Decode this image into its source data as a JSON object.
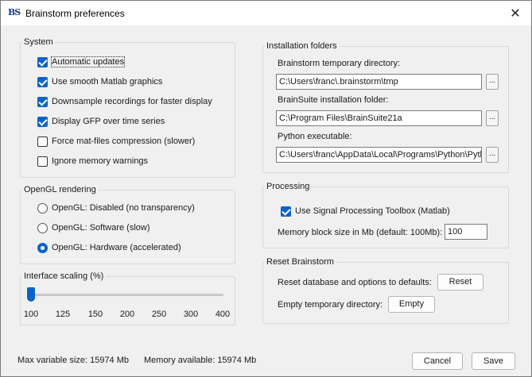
{
  "window": {
    "title": "Brainstorm preferences",
    "logo": "BS"
  },
  "system": {
    "legend": "System",
    "options": [
      {
        "label": "Automatic updates",
        "checked": true
      },
      {
        "label": "Use smooth Matlab graphics",
        "checked": true
      },
      {
        "label": "Downsample recordings for faster display",
        "checked": true
      },
      {
        "label": "Display GFP over time series",
        "checked": true
      },
      {
        "label": "Force mat-files compression (slower)",
        "checked": false
      },
      {
        "label": "Ignore memory warnings",
        "checked": false
      }
    ]
  },
  "opengl": {
    "legend": "OpenGL rendering",
    "options": [
      {
        "label": "OpenGL: Disabled (no transparency)",
        "selected": false
      },
      {
        "label": "OpenGL: Software (slow)",
        "selected": false
      },
      {
        "label": "OpenGL: Hardware (accelerated)",
        "selected": true
      }
    ]
  },
  "scaling": {
    "legend": "Interface scaling (%)",
    "value": 100,
    "ticks": [
      "100",
      "125",
      "150",
      "200",
      "250",
      "300",
      "400"
    ]
  },
  "installation": {
    "legend": "Installation folders",
    "tmp_label": "Brainstorm temporary directory:",
    "tmp_value": "C:\\Users\\franc\\.brainstorm\\tmp",
    "brainsuite_label": "BrainSuite installation folder:",
    "brainsuite_value": "C:\\Program Files\\BrainSuite21a",
    "python_label": "Python executable:",
    "python_value": "C:\\Users\\franc\\AppData\\Local\\Programs\\Python\\Python",
    "browse_label": "..."
  },
  "processing": {
    "legend": "Processing",
    "spt_label": "Use Signal Processing Toolbox (Matlab)",
    "spt_checked": true,
    "memblock_label": "Memory block size in Mb (default: 100Mb):",
    "memblock_value": "100"
  },
  "reset": {
    "legend": "Reset Brainstorm",
    "reset_db_label": "Reset database and options to defaults:",
    "reset_button": "Reset",
    "empty_tmp_label": "Empty temporary directory:",
    "empty_button": "Empty"
  },
  "status": {
    "max_var": "Max variable size: 15974 Mb",
    "mem_avail": "Memory available: 15974 Mb"
  },
  "footer": {
    "cancel": "Cancel",
    "save": "Save"
  },
  "colors": {
    "accent": "#0a64c8",
    "background": "#f0f0f0"
  }
}
